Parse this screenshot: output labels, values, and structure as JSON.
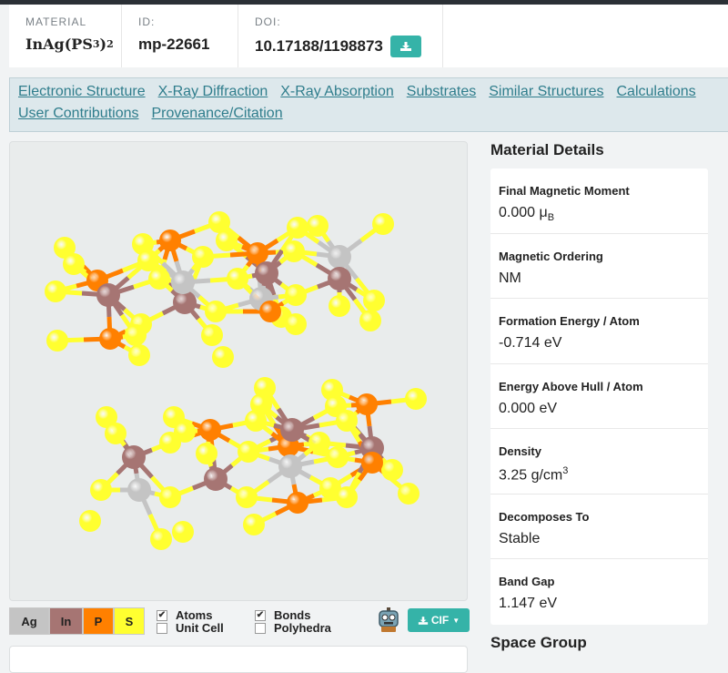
{
  "header": {
    "material_label": "MATERIAL",
    "formula_main": "InAg(PS",
    "formula_sub1": "3",
    "formula_close": ")",
    "formula_sub2": "2",
    "id_label": "ID:",
    "id_value": "mp-22661",
    "doi_label": "DOI:",
    "doi_value": "10.17188/1198873"
  },
  "nav": {
    "row1": [
      "Electronic Structure",
      "X-Ray Diffraction",
      "X-Ray Absorption",
      "Substrates",
      "Similar Structures",
      "Calculations"
    ],
    "row2": [
      "User Contributions",
      "Provenance/Citation"
    ]
  },
  "viewer": {
    "elements": [
      {
        "label": "Ag",
        "color": "#c4c4c4"
      },
      {
        "label": "In",
        "color": "#a67573"
      },
      {
        "label": "P",
        "color": "#ff8000"
      },
      {
        "label": "S",
        "color": "#ffff30"
      }
    ],
    "options": {
      "atoms": "Atoms",
      "atoms_checked": true,
      "unit_cell": "Unit Cell",
      "unit_cell_checked": false,
      "bonds": "Bonds",
      "bonds_checked": true,
      "polyhedra": "Polyhedra",
      "polyhedra_checked": false
    },
    "download_label": "CIF",
    "icons": [
      "robot-icon",
      "download-icon",
      "caret-down-icon"
    ]
  },
  "details": {
    "title": "Material Details",
    "rows": [
      {
        "key": "Final Magnetic Moment",
        "value": "0.000 μ",
        "value_sub": "B"
      },
      {
        "key": "Magnetic Ordering",
        "value": "NM"
      },
      {
        "key": "Formation Energy / Atom",
        "value": "-0.714 eV"
      },
      {
        "key": "Energy Above Hull / Atom",
        "value": "0.000 eV"
      },
      {
        "key": "Density",
        "value": "3.25 g/cm",
        "value_sup": "3"
      },
      {
        "key": "Decomposes To",
        "value": "Stable"
      },
      {
        "key": "Band Gap",
        "value": "1.147 eV"
      }
    ]
  },
  "space_group": {
    "title": "Space Group"
  },
  "colors": {
    "accent": "#35b3a8",
    "link": "#2f7d8c",
    "nav_bg": "#dde8ec"
  }
}
